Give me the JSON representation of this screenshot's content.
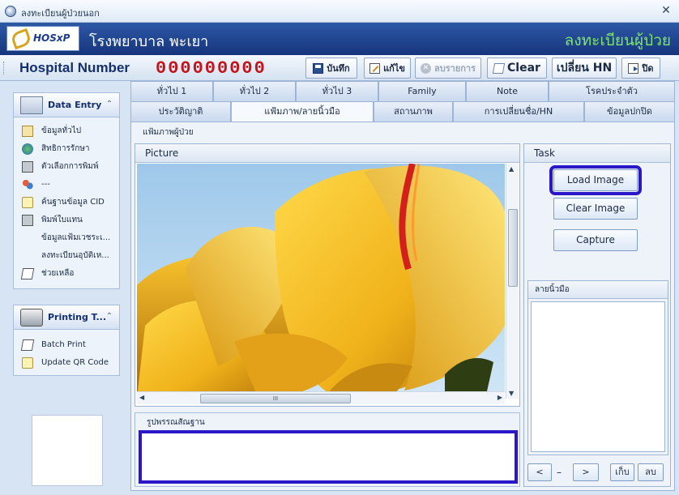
{
  "window": {
    "title": "ลงทะเบียนผู้ป่วยนอก",
    "close_glyph": "✕"
  },
  "banner": {
    "logo_text": "HOSxP",
    "hospital_name": "โรงพยาบาล พะเยา",
    "module_title": "ลงทะเบียนผู้ป่วย"
  },
  "toolbar": {
    "hn_label": "Hospital Number",
    "hn_value": "000000000",
    "save_label": "บันทึก",
    "edit_label": "แก้ไข",
    "delete_label": "ลบรายการ",
    "clear_label": "Clear",
    "change_hn_label": "เปลี่ยน HN",
    "close_label": "ปิด"
  },
  "sidebar": {
    "data_entry": {
      "title": "Data Entry",
      "collapse_glyph": "⌃",
      "items": [
        {
          "label": "ข้อมูลทั่วไป",
          "icon": "book-icon"
        },
        {
          "label": "สิทธิการรักษา",
          "icon": "globe-icon"
        },
        {
          "label": "ตัวเลือกการพิมพ์",
          "icon": "printer-icon"
        },
        {
          "label": "---",
          "icon": "people-icon"
        },
        {
          "label": "ค้นฐานข้อมูล CID",
          "icon": "chat-icon"
        },
        {
          "label": "พิมพ์ใบแทน",
          "icon": "printer-icon"
        },
        {
          "label": "ข้อมูลแฟ้มเวชระเ...",
          "icon": ""
        },
        {
          "label": "ลงทะเบียนอุบัติเห...",
          "icon": ""
        },
        {
          "label": "ช่วยเหลือ",
          "icon": "help-icon"
        }
      ]
    },
    "printing": {
      "title": "Printing T...",
      "collapse_glyph": "⌃",
      "items": [
        {
          "label": "Batch Print",
          "icon": "help-icon"
        },
        {
          "label": "Update QR Code",
          "icon": "chat-icon"
        }
      ]
    }
  },
  "tabs": {
    "row1": [
      "ทั่วไป 1",
      "ทั่วไป 2",
      "ทั่วไป 3",
      "Family",
      "Note",
      "โรคประจำตัว"
    ],
    "row2": [
      "ประวัติญาติ",
      "แฟ้มภาพ/ลายนิ้วมือ",
      "สถานภาพ",
      "การเปลี่ยนชื่อ/HN",
      "ข้อมูลปกปิด"
    ],
    "active": "แฟ้มภาพ/ลายนิ้วมือ"
  },
  "content": {
    "section_title": "แฟ้มภาพผู้ป่วย",
    "picture_label": "Picture",
    "scroll_grip": "III",
    "description_label": "รูปพรรณสัณฐาน",
    "description_value": "",
    "task_label": "Task",
    "load_image_label": "Load Image",
    "clear_image_label": "Clear Image",
    "capture_label": "Capture",
    "fingerprint_label": "ลายนิ้วมือ",
    "prev_label": "<",
    "next_label": ">",
    "store_label": "เก็บ",
    "delete_label": "ลบ"
  },
  "colors": {
    "banner": "#1f469a",
    "hn_digits": "#c2151d",
    "module_title": "#7fe36b",
    "focus_outline": "#2a18c8"
  }
}
